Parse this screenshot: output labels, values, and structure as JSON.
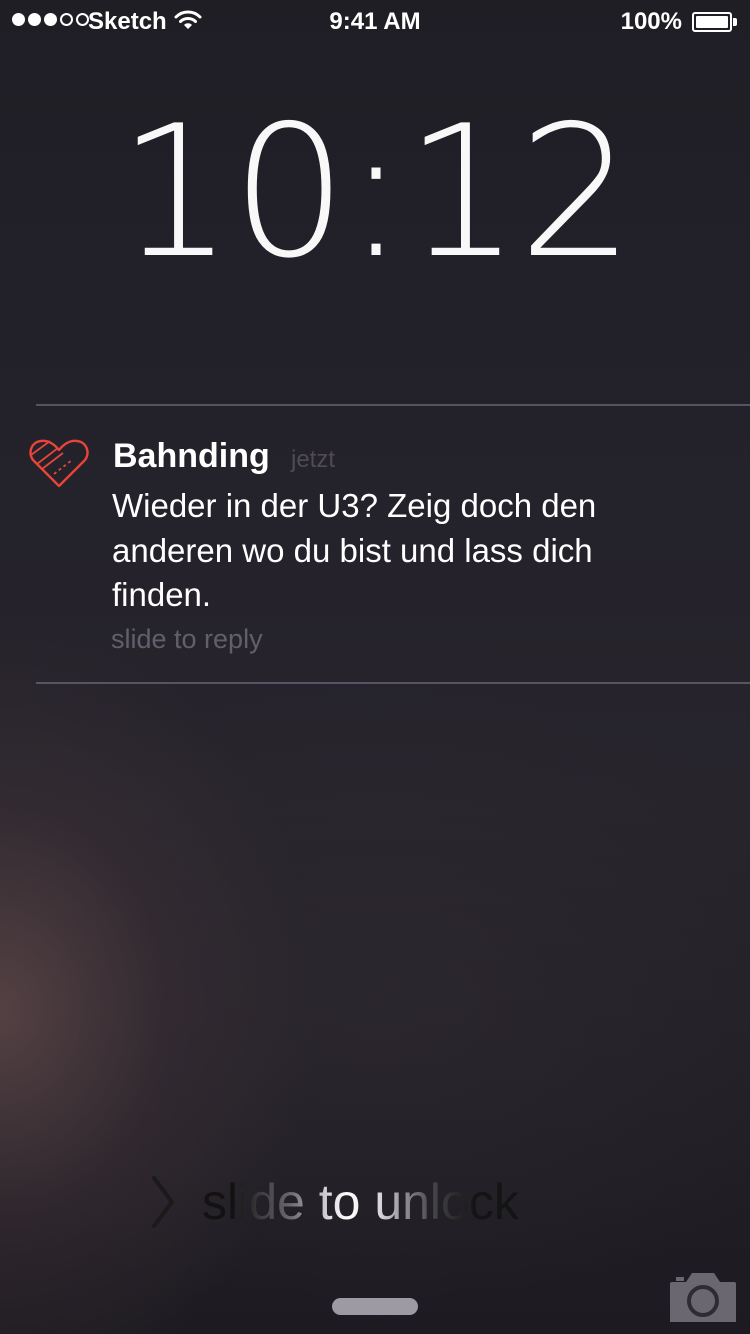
{
  "status_bar": {
    "carrier": "Sketch",
    "time": "9:41 AM",
    "battery_percent": "100%",
    "signal_bars_filled": 3,
    "signal_bars_total": 5,
    "battery_level": 1.0
  },
  "lock_screen": {
    "time": "10:12",
    "date": ""
  },
  "notification": {
    "app_name": "Bahnding",
    "timestamp": "jetzt",
    "message": "Wieder in der U3? Zeig doch den anderen wo du bist und lass dich finden.",
    "action_hint": "slide to reply",
    "icon": "heart-ticket-icon",
    "icon_color": "#e8443a"
  },
  "unlock": {
    "label": "slide to unlock",
    "icon": "chevron-right-icon"
  },
  "bottom": {
    "camera_icon": "camera-icon",
    "grabber": "control-center-grabber"
  },
  "colors": {
    "background": "#222028",
    "divider": "#5b5a68",
    "accent": "#e8443a"
  }
}
